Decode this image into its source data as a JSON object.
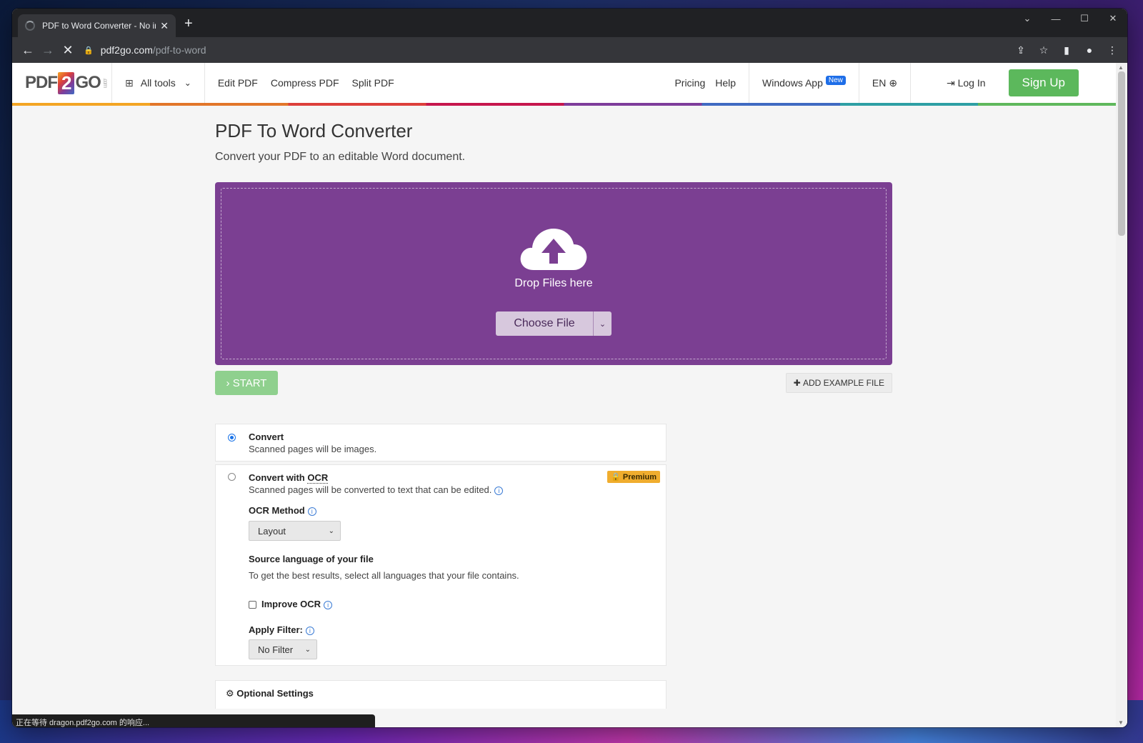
{
  "browser": {
    "tab_title": "PDF to Word Converter - No in",
    "url_host": "pdf2go.com",
    "url_path": "/pdf-to-word"
  },
  "header": {
    "logo_left": "PDF",
    "logo_mid": "2",
    "logo_right": "GO",
    "logo_suffix": ".com",
    "all_tools": "All tools",
    "nav": [
      "Edit PDF",
      "Compress PDF",
      "Split PDF"
    ],
    "pricing": "Pricing",
    "help": "Help",
    "windows_app": "Windows App",
    "new_badge": "New",
    "language": "EN",
    "login": "Log In",
    "signup": "Sign Up"
  },
  "main": {
    "title": "PDF To Word Converter",
    "subtitle": "Convert your PDF to an editable Word document.",
    "drop_label": "Drop Files here",
    "choose_file": "Choose File",
    "start": "START",
    "add_example": "ADD EXAMPLE FILE"
  },
  "options": {
    "convert_title": "Convert",
    "convert_desc": "Scanned pages will be images.",
    "ocr_title_prefix": "Convert with ",
    "ocr_title_abbr": "OCR",
    "premium": "Premium",
    "ocr_desc": "Scanned pages will be converted to text that can be edited.",
    "ocr_method_label": "OCR Method",
    "ocr_method_value": "Layout",
    "source_lang_label": "Source language of your file",
    "source_lang_desc": "To get the best results, select all languages that your file contains.",
    "improve_ocr": "Improve OCR",
    "apply_filter_label": "Apply Filter:",
    "apply_filter_value": "No Filter",
    "optional_settings": "Optional Settings"
  },
  "status": "正在等待 dragon.pdf2go.com 的响应...",
  "colors": {
    "accent_purple": "#7b3f92",
    "signup_green": "#5cb85c",
    "start_green": "#8fd08e",
    "premium_orange": "#f0ad2e"
  }
}
